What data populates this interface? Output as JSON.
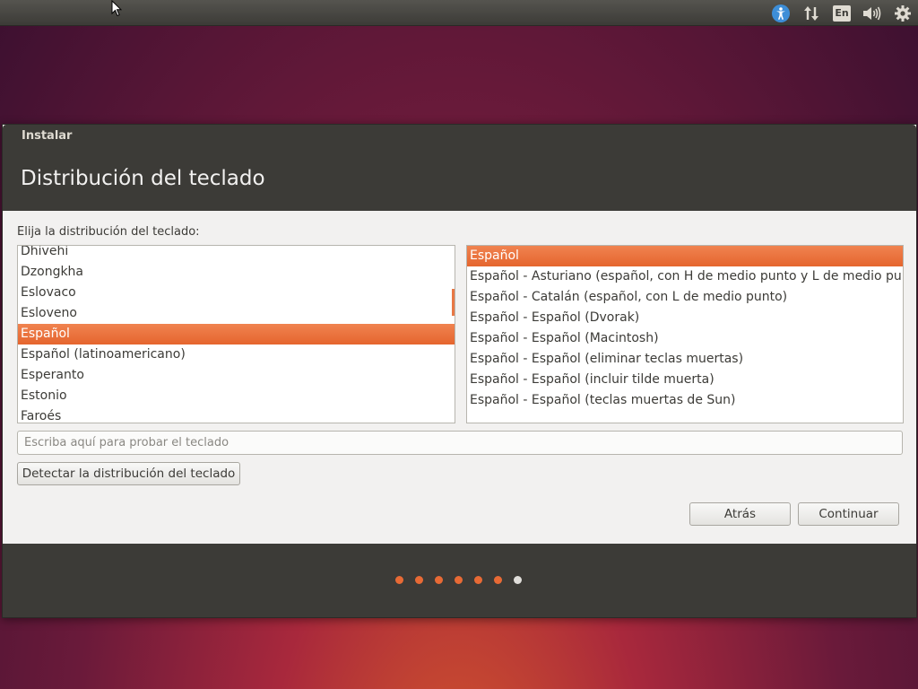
{
  "colors": {
    "accent": "#e86a35",
    "dot_done": "#e86a35",
    "dot_current": "#e0deda"
  },
  "panel": {
    "keyboard_indicator": "En",
    "icons": [
      "accessibility-icon",
      "network-icon",
      "keyboard-indicator",
      "volume-icon",
      "gear-icon"
    ]
  },
  "window": {
    "title": "Instalar",
    "page_title": "Distribución del teclado"
  },
  "prompt": "Elija la distribución del teclado:",
  "layouts": {
    "items": [
      "Dhivehi",
      "Dzongkha",
      "Eslovaco",
      "Esloveno",
      "Español",
      "Español (latinoamericano)",
      "Esperanto",
      "Estonio",
      "Faroés"
    ],
    "selected": "Español"
  },
  "variants": {
    "items": [
      "Español",
      "Español - Asturiano (español, con H de medio punto y L de medio punto)",
      "Español - Catalán (español, con L de medio punto)",
      "Español - Español (Dvorak)",
      "Español - Español (Macintosh)",
      "Español - Español (eliminar teclas muertas)",
      "Español - Español (incluir tilde muerta)",
      "Español - Español (teclas muertas de Sun)"
    ],
    "selected": "Español"
  },
  "test_input": {
    "placeholder": "Escriba aquí para probar el teclado",
    "value": ""
  },
  "buttons": {
    "detect": "Detectar la distribución del teclado",
    "back": "Atrás",
    "continue": "Continuar"
  },
  "progress": {
    "total_steps": 7,
    "current_step": 7
  }
}
